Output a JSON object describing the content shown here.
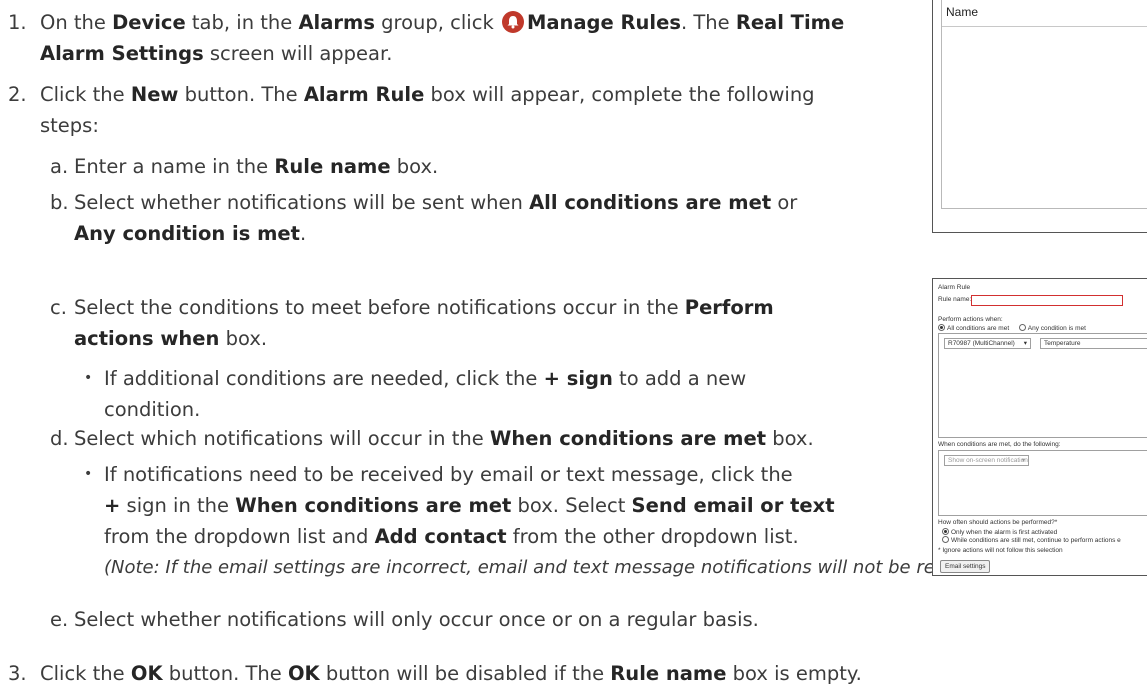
{
  "steps": [
    {
      "num": "1.",
      "line1_pre": "On the ",
      "device": "Device",
      "line1_mid1": " tab, in the ",
      "alarms": "Alarms",
      "line1_mid2": " group, click ",
      "manage_rules": "Manage Rules",
      "line1_mid3": ". The ",
      "real_time": "Real Time",
      "alarm_settings": "Alarm Settings",
      "line2_post": " screen will appear."
    },
    {
      "num": "2.",
      "line1_pre": "Click the ",
      "new": "New",
      "line1_mid": " button. The ",
      "alarm_rule": "Alarm Rule",
      "line1_post": " box will appear, complete the following",
      "line2": "steps:"
    },
    {
      "num": "3.",
      "pre": "Click the ",
      "ok1": "OK",
      "mid1": " button. The ",
      "ok2": "OK",
      "mid2": " button will be disabled if the ",
      "rule_name": "Rule name",
      "post": " box is empty."
    }
  ],
  "substeps": {
    "a": {
      "letter": "a.",
      "pre": "Enter a name in the ",
      "bold": "Rule name",
      "post": " box."
    },
    "b": {
      "letter": "b.",
      "pre": "Select whether notifications will be sent when ",
      "bold1": "All conditions are met",
      "mid": " or",
      "bold2": "Any condition is met",
      "post": "."
    },
    "c": {
      "letter": "c.",
      "pre": "Select the conditions to meet before notifications occur in the ",
      "bold1": "Perform",
      "bold2": "actions when",
      "post": " box."
    },
    "c_bullet": {
      "pre": "If additional conditions are needed, click the ",
      "bold": "+ sign",
      "post": " to add a new",
      "line2": "condition."
    },
    "d": {
      "letter": "d.",
      "pre": "Select which notifications will occur in the ",
      "bold": "When conditions are met",
      "post": " box."
    },
    "d_bullet": {
      "line1": "If notifications need to be received by email or text message, click the",
      "plus": "+",
      "l2_mid": " sign in the ",
      "l2_bold1": "When conditions are met",
      "l2_mid2": " box. Select ",
      "l2_bold2": "Send email or text",
      "l3_pre": "from the dropdown list and ",
      "l3_bold": "Add contact",
      "l3_post": " from the other dropdown list.",
      "note": "(Note: If the email settings are incorrect, email and text message notifications will not be received.)"
    },
    "e": {
      "letter": "e.",
      "text": "Select whether notifications will only occur once or on a regular basis."
    }
  },
  "rules_list": {
    "header": "Name"
  },
  "alarm_rule_dialog": {
    "title": "Alarm Rule",
    "rule_name_label": "Rule name:",
    "perform_when": "Perform actions when:",
    "all_conditions": "All conditions are met",
    "any_condition": "Any condition is met",
    "device_select": "R70987 (MultiChannel)",
    "measure_select": "Temperature",
    "when_met_label": "When conditions are met, do the following:",
    "action_select": "Show on-screen notification",
    "how_often": "How often should actions be performed?*",
    "only_first": "Only when the alarm is first activated",
    "while_met": "While conditions are still met, continue to perform actions e",
    "ignore_note": "* Ignore actions will not follow this selection",
    "email_settings": "Email settings"
  },
  "colors": {
    "alarm_icon": "#c0392b",
    "error_border": "#d23030"
  }
}
